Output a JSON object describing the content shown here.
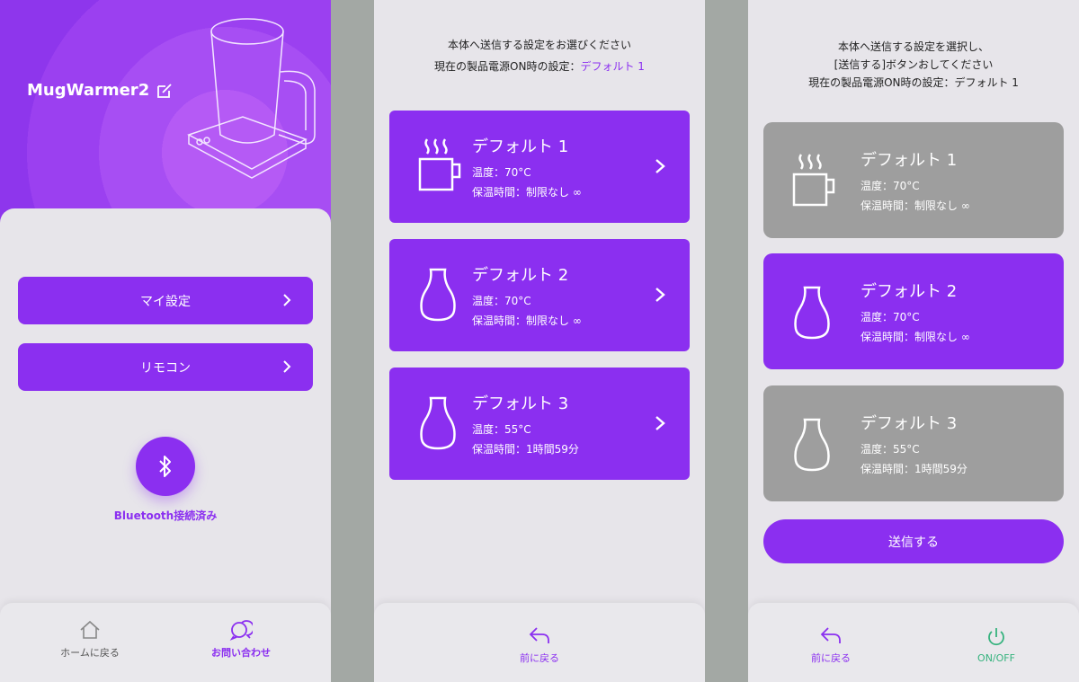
{
  "screen1": {
    "app_title": "MugWarmer2",
    "buttons": [
      {
        "label": "マイ設定"
      },
      {
        "label": "リモコン"
      }
    ],
    "bluetooth_status": "Bluetooth接続済み",
    "bottom_tabs": [
      {
        "label": "ホームに戻る",
        "icon": "home-icon"
      },
      {
        "label": "お問い合わせ",
        "icon": "chat-icon"
      }
    ]
  },
  "screen2": {
    "header_line1": "本体へ送信する設定をお選びください",
    "header_line2_prefix": "現在の製品電源ON時の設定：",
    "header_line2_value": "デフォルト 1",
    "cards": [
      {
        "name": "デフォルト 1",
        "temp": "温度：70°C",
        "time": "保温時間：制限なし ∞",
        "icon": "mug-icon"
      },
      {
        "name": "デフォルト 2",
        "temp": "温度：70°C",
        "time": "保温時間：制限なし ∞",
        "icon": "bottle-icon"
      },
      {
        "name": "デフォルト 3",
        "temp": "温度：55°C",
        "time": "保温時間：1時間59分",
        "icon": "bottle-icon"
      }
    ],
    "back_label": "前に戻る"
  },
  "screen3": {
    "header_line1": "本体へ送信する設定を選択し、",
    "header_line2": "[送信する]ボタンおしてください",
    "header_line3": "現在の製品電源ON時の設定：デフォルト 1",
    "cards": [
      {
        "name": "デフォルト 1",
        "temp": "温度：70°C",
        "time": "保温時間：制限なし ∞",
        "icon": "mug-icon",
        "selected": false
      },
      {
        "name": "デフォルト 2",
        "temp": "温度：70°C",
        "time": "保温時間：制限なし ∞",
        "icon": "bottle-icon",
        "selected": true
      },
      {
        "name": "デフォルト 3",
        "temp": "温度：55°C",
        "time": "保温時間：1時間59分",
        "icon": "bottle-icon",
        "selected": false
      }
    ],
    "send_label": "送信する",
    "back_label": "前に戻る",
    "power_label": "ON/OFF"
  },
  "colors": {
    "accent": "#8b2ff0",
    "gray_card": "#9e9e9e",
    "power_green": "#36b37e",
    "background": "#e7e5ea"
  }
}
